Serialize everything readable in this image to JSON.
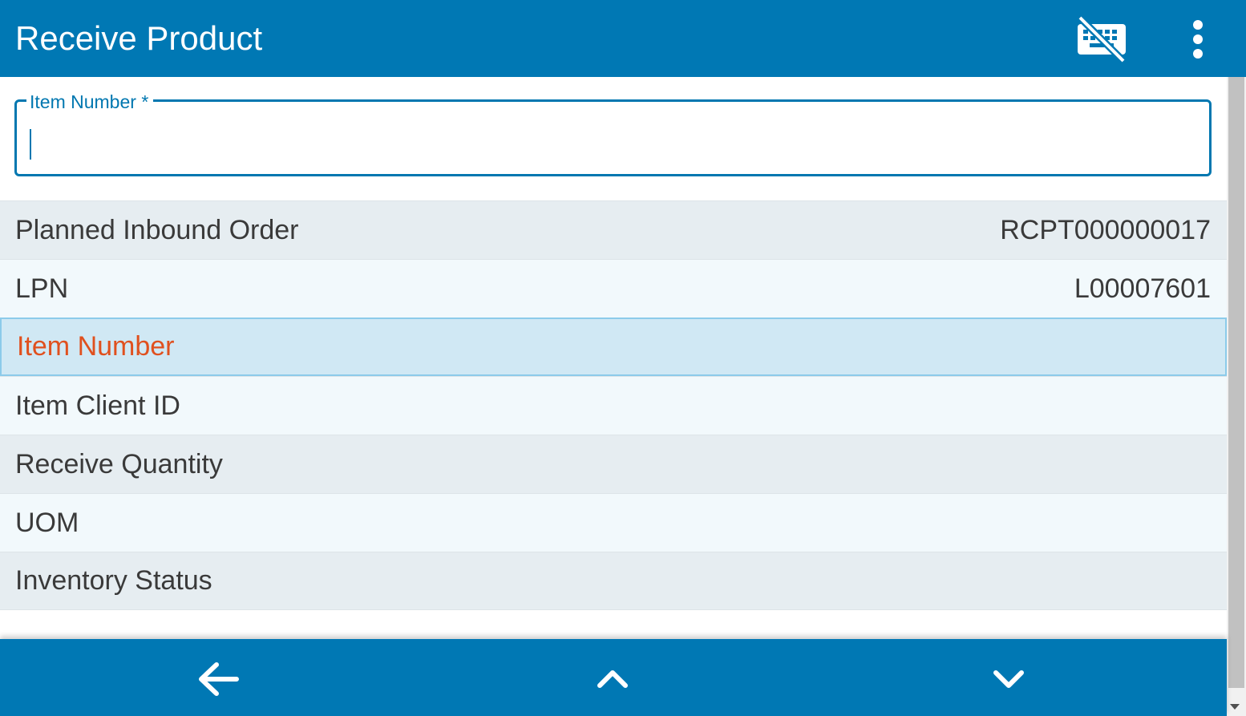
{
  "header": {
    "title": "Receive Product",
    "keyboard_icon": "keyboard-off-icon",
    "menu_icon": "more-vertical-icon"
  },
  "input": {
    "label": "Item Number *",
    "value": ""
  },
  "rows": [
    {
      "label": "Planned Inbound Order",
      "value": "RCPT000000017"
    },
    {
      "label": "LPN",
      "value": "L00007601"
    },
    {
      "label": "Item Number",
      "value": ""
    },
    {
      "label": "Item Client ID",
      "value": ""
    },
    {
      "label": "Receive Quantity",
      "value": ""
    },
    {
      "label": "UOM",
      "value": ""
    },
    {
      "label": "Inventory Status",
      "value": ""
    }
  ],
  "bottom_nav": {
    "back_icon": "arrow-left-icon",
    "up_icon": "chevron-up-icon",
    "down_icon": "chevron-down-icon"
  },
  "colors": {
    "primary": "#0078b4",
    "active_text": "#e0501e",
    "active_bg": "#d0e8f4"
  }
}
